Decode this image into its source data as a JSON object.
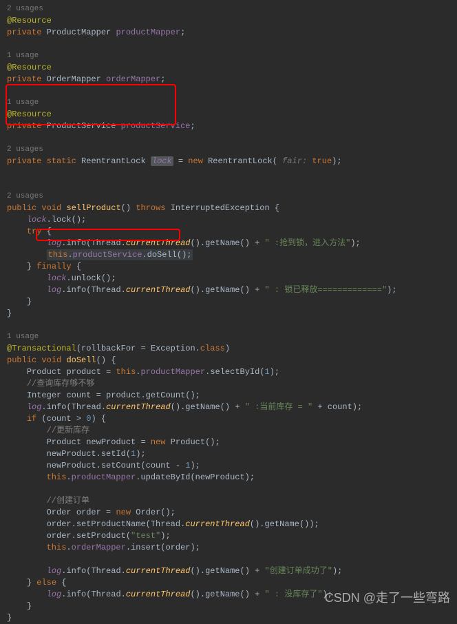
{
  "usages": {
    "u2": "2 usages",
    "u1": "1 usage"
  },
  "annotations": {
    "resource": "@Resource",
    "transactional_prefix": "@Transactional",
    "transactional_args": "(rollbackFor = Exception."
  },
  "keywords": {
    "private": "private",
    "static": "static",
    "new": "new",
    "true": "true",
    "public": "public",
    "void": "void",
    "throws": "throws",
    "try": "try",
    "finally": "finally",
    "this": "this",
    "if": "if",
    "else": "else",
    "class": "class"
  },
  "types": {
    "ProductMapper": "ProductMapper",
    "OrderMapper": "OrderMapper",
    "ProductService": "ProductService",
    "ReentrantLock": "ReentrantLock",
    "InterruptedException": "InterruptedException",
    "Product": "Product",
    "Integer": "Integer",
    "Order": "Order",
    "Thread": "Thread"
  },
  "fields": {
    "productMapper": "productMapper",
    "orderMapper": "orderMapper",
    "productService": "productService",
    "lock": "lock",
    "log": "log"
  },
  "methods": {
    "sellProduct": "sellProduct",
    "doSell": "doSell",
    "lockM": "lock",
    "unlock": "unlock",
    "info": "info",
    "currentThread": "currentThread",
    "getName": "getName",
    "selectById": "selectById",
    "getCount": "getCount",
    "setId": "setId",
    "setCount": "setCount",
    "updateById": "updateById",
    "setProductName": "setProductName",
    "setProduct": "setProduct",
    "insert": "insert"
  },
  "strings": {
    "s1": "\" :抢到锁，进入方法\"",
    "s2": "\" : 锁已释放=============\"",
    "s3": "\" :当前库存 = \"",
    "s4": "\"test\"",
    "s5": "\"创建订单成功了\"",
    "s6": "\" : 没库存了\""
  },
  "comments": {
    "c1": "//查询库存够不够",
    "c2": "//更新库存",
    "c3": "//创建订单"
  },
  "params": {
    "fair": "fair:"
  },
  "numbers": {
    "n0": "0",
    "n1": "1"
  },
  "locals": {
    "product": "product",
    "count": "count",
    "newProduct": "newProduct",
    "order": "order"
  },
  "watermark": "CSDN @走了一些弯路"
}
